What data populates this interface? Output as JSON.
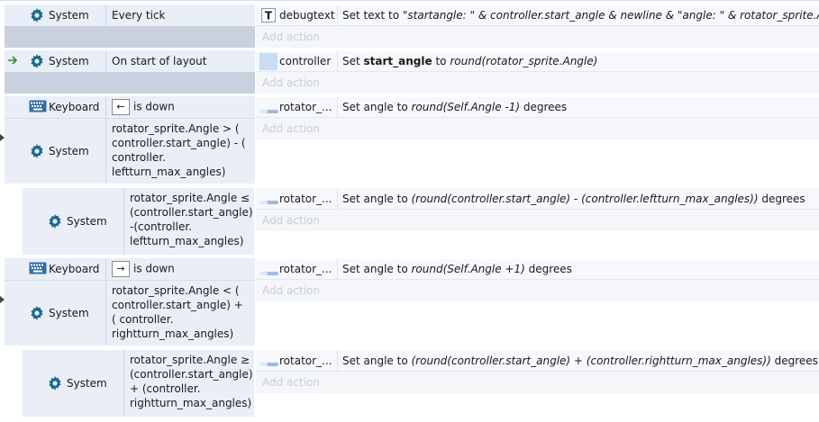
{
  "events": [
    {
      "conditions": [
        {
          "object": "System",
          "text": "Every tick"
        }
      ],
      "action": {
        "object": "debugtext",
        "pre": "Set text to ",
        "expr": "\"startangle: \" & controller.start_angle & newline & \"angle: \" & rotator_sprite.Angle"
      },
      "add_action": "Add action"
    },
    {
      "conditions": [
        {
          "object": "System",
          "text": "On start of layout"
        }
      ],
      "action": {
        "object": "controller",
        "pre": "Set ",
        "bold": "start_angle",
        "mid": " to ",
        "expr": "round(rotator_sprite.Angle)"
      },
      "add_action": "Add action"
    },
    {
      "conditions": [
        {
          "object": "Keyboard",
          "key": "←",
          "text": "is down"
        },
        {
          "object": "System",
          "text": "rotator_sprite.Angle > ( controller.start_angle) - ( controller. leftturn_max_angles)"
        }
      ],
      "action": {
        "object": "rotator_...",
        "pre": "Set angle to ",
        "expr": "round(Self.Angle -1)",
        "post": " degrees"
      },
      "add_action": "Add action",
      "sub": {
        "conditions": [
          {
            "object": "System",
            "text": "rotator_sprite.Angle ≤ (controller.start_angle) -(controller. leftturn_max_angles)"
          }
        ],
        "action": {
          "object": "rotator_...",
          "pre": "Set angle to ",
          "expr": "(round(controller.start_angle) - (controller.leftturn_max_angles))",
          "post": " degrees"
        },
        "add_action": "Add action"
      }
    },
    {
      "conditions": [
        {
          "object": "Keyboard",
          "key": "→",
          "text": "is down"
        },
        {
          "object": "System",
          "text": "rotator_sprite.Angle < ( controller.start_angle) + ( controller. rightturn_max_angles)"
        }
      ],
      "action": {
        "object": "rotator_...",
        "pre": "Set angle to ",
        "expr": "round(Self.Angle +1)",
        "post": " degrees"
      },
      "add_action": "Add action",
      "sub": {
        "conditions": [
          {
            "object": "System",
            "text": "rotator_sprite.Angle ≥ (controller.start_angle) + (controller. rightturn_max_angles)"
          }
        ],
        "action": {
          "object": "rotator_...",
          "pre": "Set angle to ",
          "expr": "(round(controller.start_angle) + (controller.rightturn_max_angles))",
          "post": " degrees"
        },
        "add_action": "Add action"
      }
    }
  ],
  "icons": {
    "system": "gear-icon",
    "keyboard": "keyboard-icon",
    "text": "text-object-icon",
    "sprite": "sprite-icon",
    "trigger": "trigger-arrow-icon"
  },
  "colors": {
    "condition_bg": "#e9eef7",
    "gear": "#1b6a8e",
    "trigger": "#2e8b2e"
  }
}
